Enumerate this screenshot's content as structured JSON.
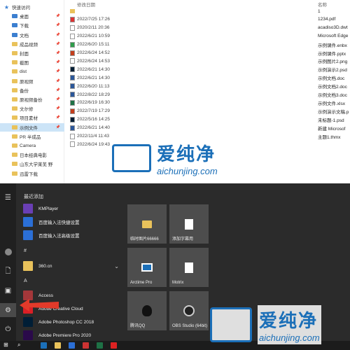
{
  "explorer": {
    "nav": [
      {
        "label": "快速访问",
        "type": "star"
      },
      {
        "label": "桌面",
        "type": "blue",
        "pinned": true
      },
      {
        "label": "下载",
        "type": "blue",
        "pinned": true
      },
      {
        "label": "文档",
        "type": "blue",
        "pinned": true
      },
      {
        "label": "成品视频",
        "type": "folder",
        "pinned": true
      },
      {
        "label": "封面",
        "type": "folder",
        "pinned": true
      },
      {
        "label": "截图",
        "type": "folder",
        "pinned": true
      },
      {
        "label": "dist",
        "type": "folder",
        "pinned": true
      },
      {
        "label": "原视频",
        "type": "folder",
        "pinned": true
      },
      {
        "label": "备份",
        "type": "folder",
        "pinned": true
      },
      {
        "label": "原视频备份",
        "type": "folder",
        "pinned": true
      },
      {
        "label": "文尔修",
        "type": "folder",
        "pinned": true
      },
      {
        "label": "项目素材",
        "type": "folder",
        "pinned": true
      },
      {
        "label": "示例文件",
        "type": "folder",
        "pinned": true,
        "selected": true
      },
      {
        "label": "PR 半成品",
        "type": "folder"
      },
      {
        "label": "Camera",
        "type": "folder"
      },
      {
        "label": "日本经典电影",
        "type": "folder"
      },
      {
        "label": "山东大学莱芜 野",
        "type": "folder"
      },
      {
        "label": "迅雷下载",
        "type": "folder"
      }
    ],
    "headers": {
      "modified": "修改日期",
      "name": "名称"
    },
    "files": [
      {
        "date": "",
        "name": "1",
        "icon": "folder"
      },
      {
        "date": "2022/7/25 17:26",
        "name": "1234.pdf",
        "icon": "pdf"
      },
      {
        "date": "2020/2/11 20:36",
        "name": "acadiso3D.dwt",
        "icon": "doc"
      },
      {
        "date": "2022/6/21 10:59",
        "name": "Microsoft Edge",
        "icon": "doc"
      },
      {
        "date": "2022/6/20 15:11",
        "name": "示例课件.enbx",
        "icon": "green"
      },
      {
        "date": "2022/6/24 14:52",
        "name": "示例课件.pptx",
        "icon": "red"
      },
      {
        "date": "2022/6/24 14:53",
        "name": "示例图片2.png",
        "icon": "doc"
      },
      {
        "date": "2022/6/21 14:30",
        "name": "示例演示2.psd",
        "icon": "ps"
      },
      {
        "date": "2022/6/21 14:30",
        "name": "示例文档.doc",
        "icon": "word"
      },
      {
        "date": "2022/6/20 11:13",
        "name": "示例文档2.doc",
        "icon": "word"
      },
      {
        "date": "2022/8/22 18:29",
        "name": "示例文档3.doc",
        "icon": "word"
      },
      {
        "date": "2022/6/19 16:30",
        "name": "示例文件.xlsx",
        "icon": "excel"
      },
      {
        "date": "2022/7/19 17:29",
        "name": "示例演示文稿.p",
        "icon": "red"
      },
      {
        "date": "2022/5/16 14:25",
        "name": "未标题-1.psd",
        "icon": "ps"
      },
      {
        "date": "2022/6/21 14:40",
        "name": "新建 Microsof",
        "icon": "word"
      },
      {
        "date": "2022/11/4 11:43",
        "name": "主题1.thmx",
        "icon": "doc"
      },
      {
        "date": "2022/6/24 19:43",
        "name": "",
        "icon": "doc"
      }
    ]
  },
  "watermark": {
    "brand": "爱纯净",
    "url": "aichunjing.com"
  },
  "start": {
    "recent_title": "最近添加",
    "apps": [
      {
        "label": "KMPlayer",
        "color": "#6a3fb5"
      },
      {
        "label": "百度输入法快捷设置",
        "color": "#2b6fd6"
      },
      {
        "label": "百度输入法高级设置",
        "color": "#2b6fd6"
      }
    ],
    "hash_section": "#",
    "apps2": [
      {
        "label": "360.cn",
        "color": "#e9c25b",
        "expandable": true
      }
    ],
    "a_section": "A",
    "apps3": [
      {
        "label": "Access",
        "color": "#a4373a"
      },
      {
        "label": "Adobe Creative Cloud",
        "color": "#da1f26"
      },
      {
        "label": "Adobe Photoshop CC 2018",
        "color": "#001e36"
      },
      {
        "label": "Adobe Premiere Pro 2020",
        "color": "#2a0a4a"
      }
    ],
    "tiles": [
      {
        "label": "临时图片66666",
        "kind": "folder"
      },
      {
        "label": "添加字幕用",
        "kind": "doc"
      },
      {
        "label": "Arctime Pro",
        "kind": "arctime"
      },
      {
        "label": "Motrix",
        "kind": "doc"
      },
      {
        "label": "腾讯QQ",
        "kind": "qq"
      },
      {
        "label": "OBS Studio (64bit)",
        "kind": "obs"
      }
    ]
  }
}
